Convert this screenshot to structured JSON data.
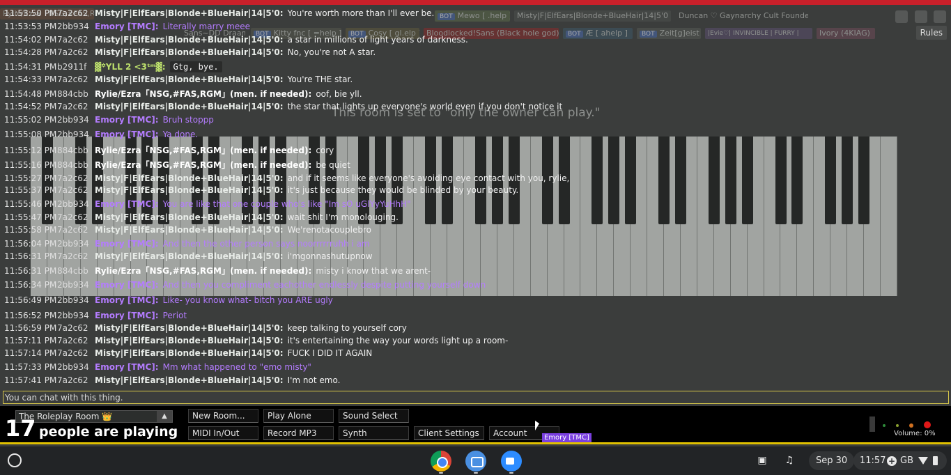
{
  "participants": [
    {
      "name": "BOT",
      "label": "Mewo [ .help ]"
    },
    {
      "label": "Misty|F|ElfEars|Blonde+BlueHair|14|5'0"
    },
    {
      "label": "Duncan ♡ Gaynarchy Cult Founder ♡"
    },
    {
      "label": "Rylie/Ezra「NSG,#FAS,RGM」(men. if needed)"
    },
    {
      "label": "Sans~DD Draama~"
    },
    {
      "bot": "BOT",
      "label": "Kitty fnc [ =help ]"
    },
    {
      "bot": "BOT",
      "label": "Cosy [ gl.elp ]"
    },
    {
      "label": "Bloodlocked!Sans (Black hole god)"
    },
    {
      "bot": "BOT",
      "label": "Æ [ ahelp ]"
    },
    {
      "bot": "BOT",
      "label": "Zeit[g]eist"
    },
    {
      "label": "|Evie♡| INVINCIBLE | FURRY |"
    },
    {
      "label": "Ivory (4KIAG)"
    }
  ],
  "rules_label": "Rules",
  "room_note": "This room is set to \"only the owner can play.\"",
  "messages": [
    {
      "time": "11:53:50 PM",
      "id": "7a2c62",
      "user": "Misty|F|ElfEars|Blonde+BlueHair|14|5'0:",
      "text": "You're worth more than I'll ever be.",
      "cls": "c-misty"
    },
    {
      "time": "11:53:53 PM",
      "id": "2bb934",
      "user": "Emory [TMC]:",
      "text": "Literally marry meee",
      "cls": "c-emory"
    },
    {
      "time": "11:54:02 PM",
      "id": "7a2c62",
      "user": "Misty|F|ElfEars|Blonde+BlueHair|14|5'0:",
      "text": "a star in millions of light years of darkness.",
      "cls": "c-misty"
    },
    {
      "time": "11:54:28 PM",
      "id": "7a2c62",
      "user": "Misty|F|ElfEars|Blonde+BlueHair|14|5'0:",
      "text": "No, you're not A star.",
      "cls": "c-misty"
    },
    {
      "time": "11:54:31 PM",
      "id": "b2911f",
      "user": "▓꙳YLL 2 <3ᵗᵐ▓:",
      "text": "Gtg, bye.",
      "cls": "c-yll"
    },
    {
      "time": "11:54:33 PM",
      "id": "7a2c62",
      "user": "Misty|F|ElfEars|Blonde+BlueHair|14|5'0:",
      "text": "You're THE star.",
      "cls": "c-misty"
    },
    {
      "time": "11:54:48 PM",
      "id": "884cbb",
      "user": "Rylie/Ezra「NSG,#FAS,RGM」(men. if needed):",
      "text": "oof, bie yll.",
      "cls": "c-rylie"
    },
    {
      "time": "11:54:52 PM",
      "id": "7a2c62",
      "user": "Misty|F|ElfEars|Blonde+BlueHair|14|5'0:",
      "text": "the star that lights up everyone's world even if you don't notice it",
      "cls": "c-misty"
    },
    {
      "time": "11:55:02 PM",
      "id": "2bb934",
      "user": "Emory [TMC]:",
      "text": "Bruh stoppp",
      "cls": "c-emory"
    },
    {
      "time": "11:55:08 PM",
      "id": "2bb934",
      "user": "Emory [TMC]:",
      "text": "Ya done.",
      "cls": "c-emory"
    },
    {
      "time": "11:55:12 PM",
      "id": "884cbb",
      "user": "Rylie/Ezra「NSG,#FAS,RGM」(men. if needed):",
      "text": "cory",
      "cls": "c-rylie"
    },
    {
      "time": "11:55:16 PM",
      "id": "884cbb",
      "user": "Rylie/Ezra「NSG,#FAS,RGM」(men. if needed):",
      "text": "be quiet",
      "cls": "c-rylie"
    },
    {
      "time": "11:55:27 PM",
      "id": "7a2c62",
      "user": "Misty|F|ElfEars|Blonde+BlueHair|14|5'0:",
      "text": "and if it seems like everyone's avoiding eye contact with you, rylie,",
      "cls": "c-misty"
    },
    {
      "time": "11:55:37 PM",
      "id": "7a2c62",
      "user": "Misty|F|ElfEars|Blonde+BlueHair|14|5'0:",
      "text": "it's just because they would be blinded by your beauty.",
      "cls": "c-misty"
    },
    {
      "time": "11:55:46 PM",
      "id": "2bb934",
      "user": "Emory [TMC]:",
      "text": "You are like that one couple who's like \"Im sO uGlYyYuHhH\"",
      "cls": "c-emory"
    },
    {
      "time": "11:55:47 PM",
      "id": "7a2c62",
      "user": "Misty|F|ElfEars|Blonde+BlueHair|14|5'0:",
      "text": "wait shit I'm monolouging.",
      "cls": "c-misty"
    },
    {
      "time": "11:55:58 PM",
      "id": "7a2c62",
      "user": "Misty|F|ElfEars|Blonde+BlueHair|14|5'0:",
      "text": "We'renotacouplebro",
      "cls": "c-misty"
    },
    {
      "time": "11:56:04 PM",
      "id": "2bb934",
      "user": "Emory [TMC]:",
      "text": "And then the other person says noorrrrrruhh i am",
      "cls": "c-emory"
    },
    {
      "time": "11:56:31 PM",
      "id": "7a2c62",
      "user": "Misty|F|ElfEars|Blonde+BlueHair|14|5'0:",
      "text": "i'mgonnashutupnow",
      "cls": "c-misty"
    },
    {
      "time": "11:56:31 PM",
      "id": "884cbb",
      "user": "Rylie/Ezra「NSG,#FAS,RGM」(men. if needed):",
      "text": "misty i know that we arent-",
      "cls": "c-rylie"
    },
    {
      "time": "11:56:34 PM",
      "id": "2bb934",
      "user": "Emory [TMC]:",
      "text": "And then you compliment eachother endlessly despite putting yourself down",
      "cls": "c-emory"
    },
    {
      "time": "11:56:49 PM",
      "id": "2bb934",
      "user": "Emory [TMC]:",
      "text": "Like- you know what- bitch you ARE ugly",
      "cls": "c-emory"
    },
    {
      "time": "11:56:52 PM",
      "id": "2bb934",
      "user": "Emory [TMC]:",
      "text": "Periot",
      "cls": "c-emory"
    },
    {
      "time": "11:56:59 PM",
      "id": "7a2c62",
      "user": "Misty|F|ElfEars|Blonde+BlueHair|14|5'0:",
      "text": "keep talking to yourself cory",
      "cls": "c-misty"
    },
    {
      "time": "11:57:11 PM",
      "id": "7a2c62",
      "user": "Misty|F|ElfEars|Blonde+BlueHair|14|5'0:",
      "text": "it's entertaining the way your words light up a room-",
      "cls": "c-misty"
    },
    {
      "time": "11:57:14 PM",
      "id": "7a2c62",
      "user": "Misty|F|ElfEars|Blonde+BlueHair|14|5'0:",
      "text": "FUCK I DID IT AGAIN",
      "cls": "c-misty"
    },
    {
      "time": "11:57:33 PM",
      "id": "2bb934",
      "user": "Emory [TMC]:",
      "text": "Mm what happened to \"emo misty\"",
      "cls": "c-emory"
    },
    {
      "time": "11:57:41 PM",
      "id": "7a2c62",
      "user": "Misty|F|ElfEars|Blonde+BlueHair|14|5'0:",
      "text": "I'm not emo.",
      "cls": "c-misty"
    }
  ],
  "chat_input": {
    "placeholder": "You can chat with this thing.",
    "value": ""
  },
  "controls": {
    "room_name": "The Roleplay Room 👑",
    "room_arrow": "▲",
    "player_count": "17",
    "player_label": "people are playing",
    "buttons": {
      "new_room": "New Room...",
      "play_alone": "Play Alone",
      "sound_select": "Sound Select",
      "midi": "MIDI In/Out",
      "record": "Record MP3",
      "synth": "Synth",
      "client_settings": "Client Settings",
      "account": "Account"
    },
    "hover_tag": "Emory [TMC]",
    "volume_label": "Volume: 0%",
    "volume": 0
  },
  "taskbar": {
    "apps": [
      "chrome-icon",
      "screenshot-icon",
      "zoom-icon"
    ],
    "date": "Sep 30",
    "time": "11:57",
    "storage": "GB"
  },
  "colors": {
    "accent_bar": "#c8202a",
    "controls_border": "#e0c000",
    "emory": "#b47cff"
  }
}
